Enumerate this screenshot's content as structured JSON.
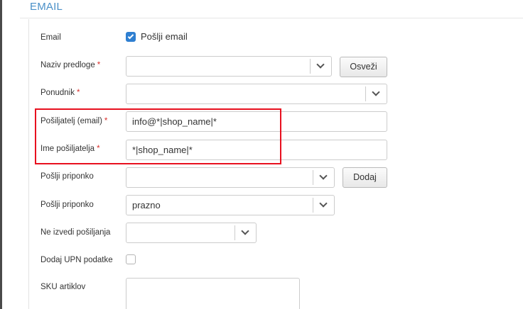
{
  "section": {
    "title": "EMAIL"
  },
  "form": {
    "email": {
      "label": "Email",
      "checkbox_label": "Pošlji email",
      "checked": true
    },
    "template_name": {
      "label": "Naziv predloge",
      "required": "*",
      "value": "",
      "refresh_label": "Osveži"
    },
    "provider": {
      "label": "Ponudnik",
      "required": "*",
      "value": ""
    },
    "sender_email": {
      "label": "Pošiljatelj (email)",
      "required": "*",
      "value": "info@*|shop_name|*"
    },
    "sender_name": {
      "label": "Ime pošiljatelja",
      "required": "*",
      "value": "*|shop_name|*"
    },
    "attachment_1": {
      "label": "Pošlji priponko",
      "value": "",
      "add_label": "Dodaj"
    },
    "attachment_2": {
      "label": "Pošlji priponko",
      "value": "prazno"
    },
    "skip_sending": {
      "label": "Ne izvedi pošiljanja",
      "value": ""
    },
    "add_upn": {
      "label": "Dodaj UPN podatke",
      "checked": false
    },
    "sku": {
      "label": "SKU artiklov",
      "value": ""
    }
  },
  "colors": {
    "title": "#4a90c8",
    "required": "#d9302c",
    "checkbox": "#2f7fd1",
    "highlight": "#e8101f"
  }
}
